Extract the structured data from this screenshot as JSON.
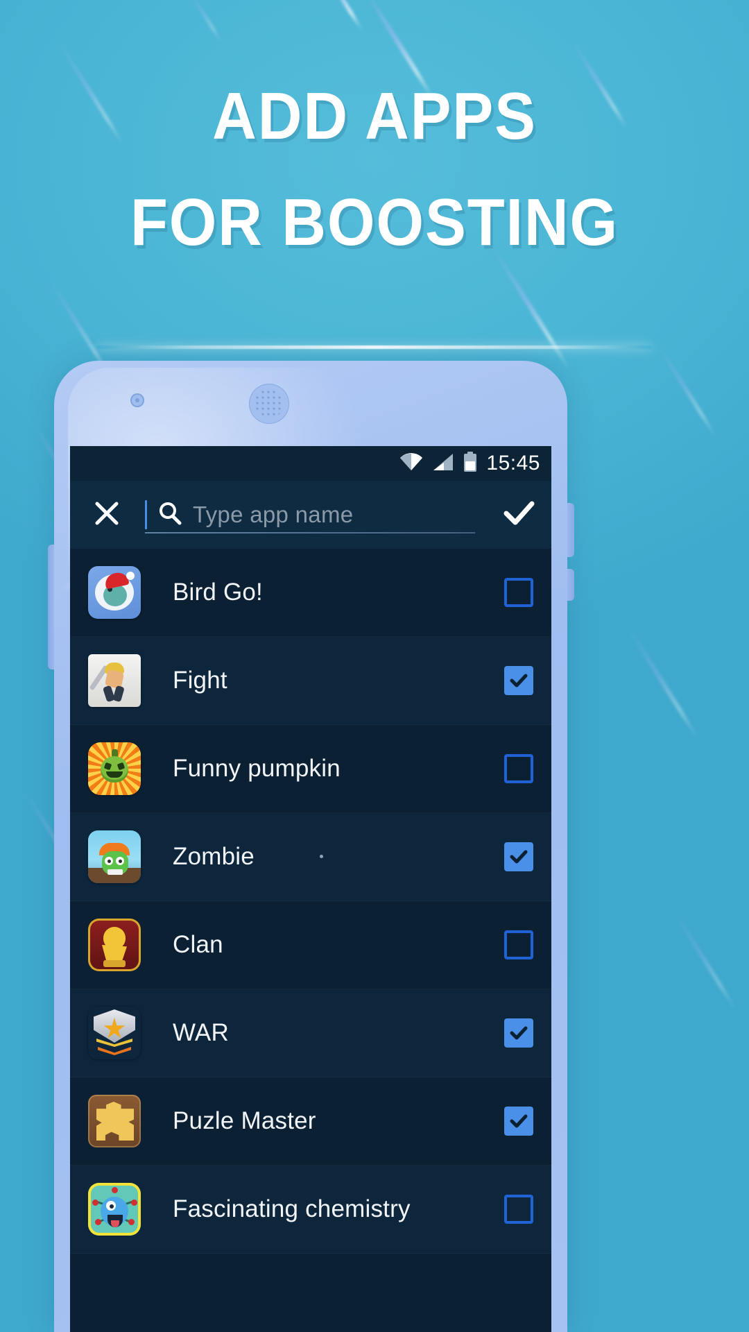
{
  "headline": {
    "line1": "ADD APPS",
    "line2": "FOR BOOSTING"
  },
  "colors": {
    "background": "#49b4d4",
    "phone_body": "#a6c2f2",
    "screen_bg": "#0b2033",
    "status_bar_bg": "#0d2436",
    "search_bar_bg": "#0f2b41",
    "checkbox_checked": "#4a90e8",
    "checkbox_unchecked_border": "#1f63d6",
    "accent_caret": "#4a90e2",
    "text_primary": "#f2f5f8",
    "placeholder": "#8a9aa8"
  },
  "status_bar": {
    "clock": "15:45",
    "wifi_icon": "wifi-icon",
    "signal_icon": "cellular-signal-icon",
    "battery_icon": "battery-icon"
  },
  "search": {
    "close_icon": "close-icon",
    "search_icon": "search-icon",
    "placeholder": "Type app name",
    "value": "",
    "confirm_icon": "check-icon"
  },
  "apps": [
    {
      "name": "Bird Go!",
      "checked": false,
      "icon": "bird-go-icon"
    },
    {
      "name": "Fight",
      "checked": true,
      "icon": "fight-icon"
    },
    {
      "name": "Funny pumpkin",
      "checked": false,
      "icon": "funny-pumpkin-icon"
    },
    {
      "name": "Zombie",
      "checked": true,
      "icon": "zombie-icon"
    },
    {
      "name": "Clan",
      "checked": false,
      "icon": "clan-icon"
    },
    {
      "name": "WAR",
      "checked": true,
      "icon": "war-icon"
    },
    {
      "name": "Puzle Master",
      "checked": true,
      "icon": "puzzle-master-icon"
    },
    {
      "name": "Fascinating chemistry",
      "checked": false,
      "icon": "fascinating-chemistry-icon"
    }
  ]
}
